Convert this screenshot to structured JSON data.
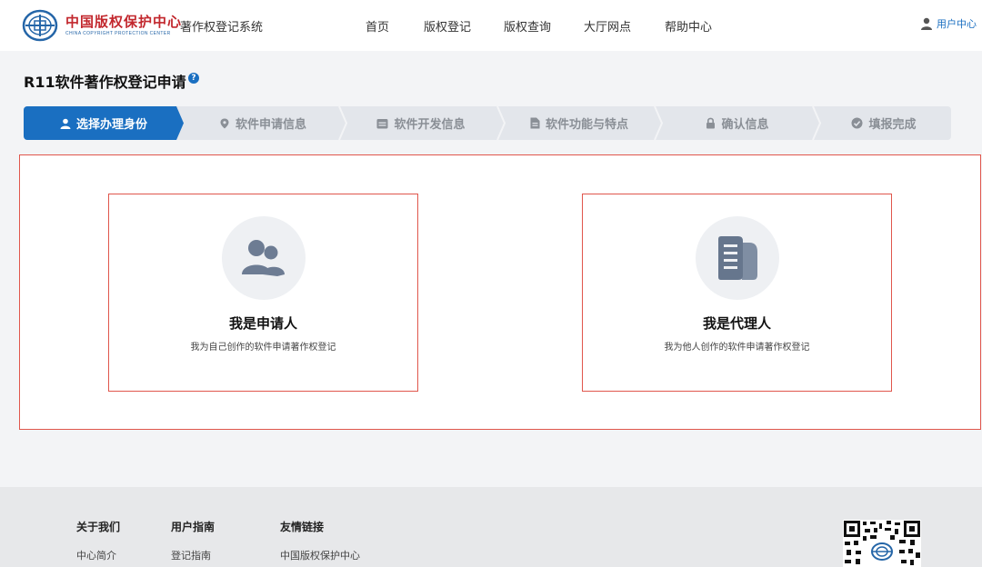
{
  "header": {
    "logo_text": "中国版权保护中心",
    "logo_subtext": "CHINA COPYRIGHT PROTECTION CENTER",
    "system_name": "著作权登记系统",
    "nav": [
      "首页",
      "版权登记",
      "版权查询",
      "大厅网点",
      "帮助中心"
    ],
    "user_center": "用户中心"
  },
  "page": {
    "title": "R11软件著作权登记申请",
    "help": "?"
  },
  "steps": [
    {
      "label": "选择办理身份",
      "icon": "user-icon",
      "active": true
    },
    {
      "label": "软件申请信息",
      "icon": "location-pin-icon",
      "active": false
    },
    {
      "label": "软件开发信息",
      "icon": "calendar-icon",
      "active": false
    },
    {
      "label": "软件功能与特点",
      "icon": "document-icon",
      "active": false
    },
    {
      "label": "确认信息",
      "icon": "lock-icon",
      "active": false
    },
    {
      "label": "填报完成",
      "icon": "check-circle-icon",
      "active": false
    }
  ],
  "identity_options": [
    {
      "title": "我是申请人",
      "desc": "我为自己创作的软件申请著作权登记",
      "icon": "users-icon"
    },
    {
      "title": "我是代理人",
      "desc": "我为他人创作的软件申请著作权登记",
      "icon": "documents-icon"
    }
  ],
  "footer": {
    "columns": [
      {
        "heading": "关于我们",
        "link": "中心简介"
      },
      {
        "heading": "用户指南",
        "link": "登记指南"
      },
      {
        "heading": "友情链接",
        "link": "中国版权保护中心"
      }
    ]
  },
  "colors": {
    "accent": "#1a6fc1",
    "highlight_border": "#e0564c",
    "logo_red": "#c2272d"
  }
}
